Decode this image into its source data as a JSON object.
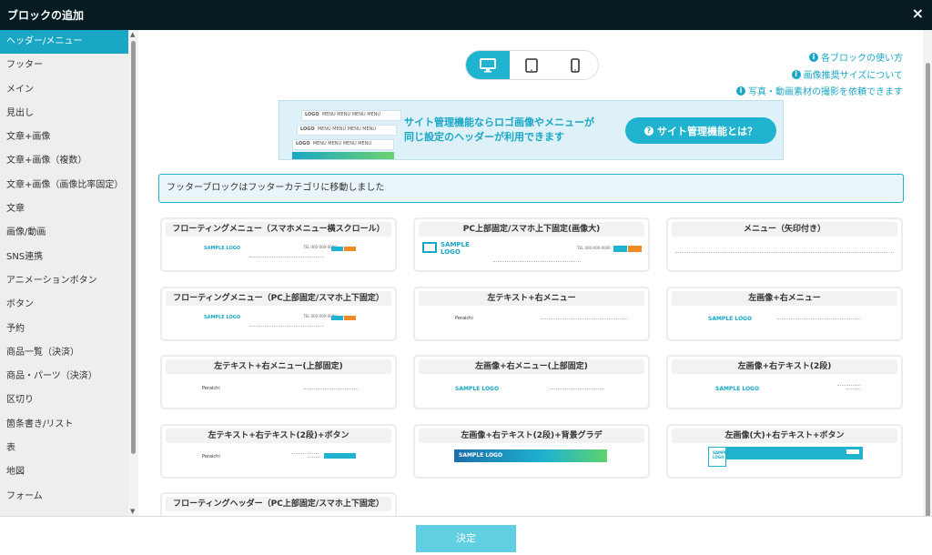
{
  "window": {
    "title": "ブロックの追加",
    "close_icon": "×"
  },
  "sidebar": {
    "items": [
      {
        "label": "ヘッダー/メニュー"
      },
      {
        "label": "フッター"
      },
      {
        "label": "メイン"
      },
      {
        "label": "見出し"
      },
      {
        "label": "文章+画像"
      },
      {
        "label": "文章+画像（複数）"
      },
      {
        "label": "文章+画像（画像比率固定）"
      },
      {
        "label": "文章"
      },
      {
        "label": "画像/動画"
      },
      {
        "label": "SNS連携"
      },
      {
        "label": "アニメーションボタン"
      },
      {
        "label": "ボタン"
      },
      {
        "label": "予約"
      },
      {
        "label": "商品一覧（決済）"
      },
      {
        "label": "商品・パーツ（決済）"
      },
      {
        "label": "区切り"
      },
      {
        "label": "箇条書き/リスト"
      },
      {
        "label": "表"
      },
      {
        "label": "地図"
      },
      {
        "label": "フォーム"
      }
    ]
  },
  "device_toggle": {
    "options": [
      "desktop-icon",
      "tablet-icon",
      "smartphone-icon"
    ],
    "selected": "desktop"
  },
  "help_links": [
    {
      "label": "各ブロックの使い方"
    },
    {
      "label": "画像推奨サイズについて"
    },
    {
      "label": "写真・動画素材の撮影を依頼できます"
    }
  ],
  "banner": {
    "line1": "サイト管理機能ならロゴ画像やメニューが",
    "line2": "同じ設定のヘッダーが利用できます",
    "button": "サイト管理機能とは？",
    "thumb_logo": "LOGO",
    "thumb_menu": "MENU MENU MENU MENU"
  },
  "notice": "フッターブロックはフッターカテゴリに移動しました",
  "cards": [
    {
      "title": "フローティングメニュー（スマホメニュー横スクロール）"
    },
    {
      "title": "PC上部固定/スマホ上下固定(画像大)"
    },
    {
      "title": "メニュー（矢印付き）"
    },
    {
      "title": "フローティングメニュー（PC上部固定/スマホ上下固定）"
    },
    {
      "title": "左テキスト+右メニュー"
    },
    {
      "title": "左画像+右メニュー"
    },
    {
      "title": "左テキスト+右メニュー(上部固定)"
    },
    {
      "title": "左画像+右メニュー(上部固定)"
    },
    {
      "title": "左画像+右テキスト(2段)"
    },
    {
      "title": "左テキスト+右テキスト(2段)+ボタン"
    },
    {
      "title": "左画像+右テキスト(2段)+背景グラデ"
    },
    {
      "title": "左画像(大)+右テキスト+ボタン"
    },
    {
      "title": "フローティングヘッダー（PC上部固定/スマホ上下固定）"
    }
  ],
  "preview_text": {
    "sample_logo": "SAMPLE LOGO",
    "sample": "SAMPLE",
    "logo": "LOGO",
    "tel": "TEL 000-000-0000",
    "brand": "Peraichi"
  },
  "footer": {
    "confirm": "決定"
  },
  "colors": {
    "accent": "#1aa7c6",
    "titlebar": "#061b22",
    "orange": "#f08a24"
  }
}
